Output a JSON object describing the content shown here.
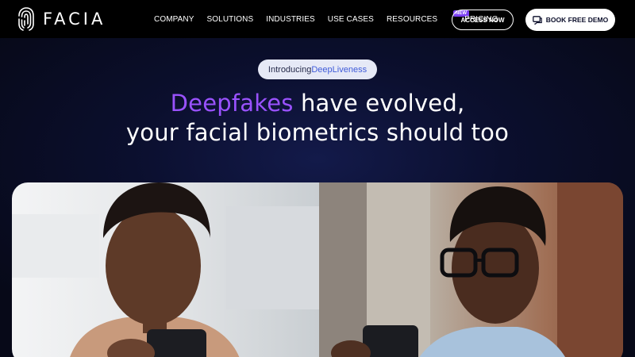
{
  "brand": {
    "name": "FACIA",
    "logo_icon": "fingerprint-icon"
  },
  "nav": {
    "links": [
      {
        "label": "COMPANY"
      },
      {
        "label": "SOLUTIONS"
      },
      {
        "label": "INDUSTRIES"
      },
      {
        "label": "USE CASES"
      },
      {
        "label": "RESOURCES",
        "badge": "NEW"
      },
      {
        "label": "PRICING"
      }
    ],
    "access_button": "ACCESS NOW",
    "demo_button": "BOOK FREE DEMO",
    "demo_icon": "chat-icon"
  },
  "hero": {
    "pill_prefix": "Introducing ",
    "pill_accent": "DeepLiveness",
    "headline_highlight": "Deepfakes",
    "headline_rest": " have evolved,",
    "headline_line2": "your facial biometrics should too"
  },
  "colors": {
    "background": "#080a1c",
    "accent_purple": "#9a52ff",
    "badge_purple": "#7b3ff2",
    "pill_accent_blue": "#3f5bd9"
  }
}
